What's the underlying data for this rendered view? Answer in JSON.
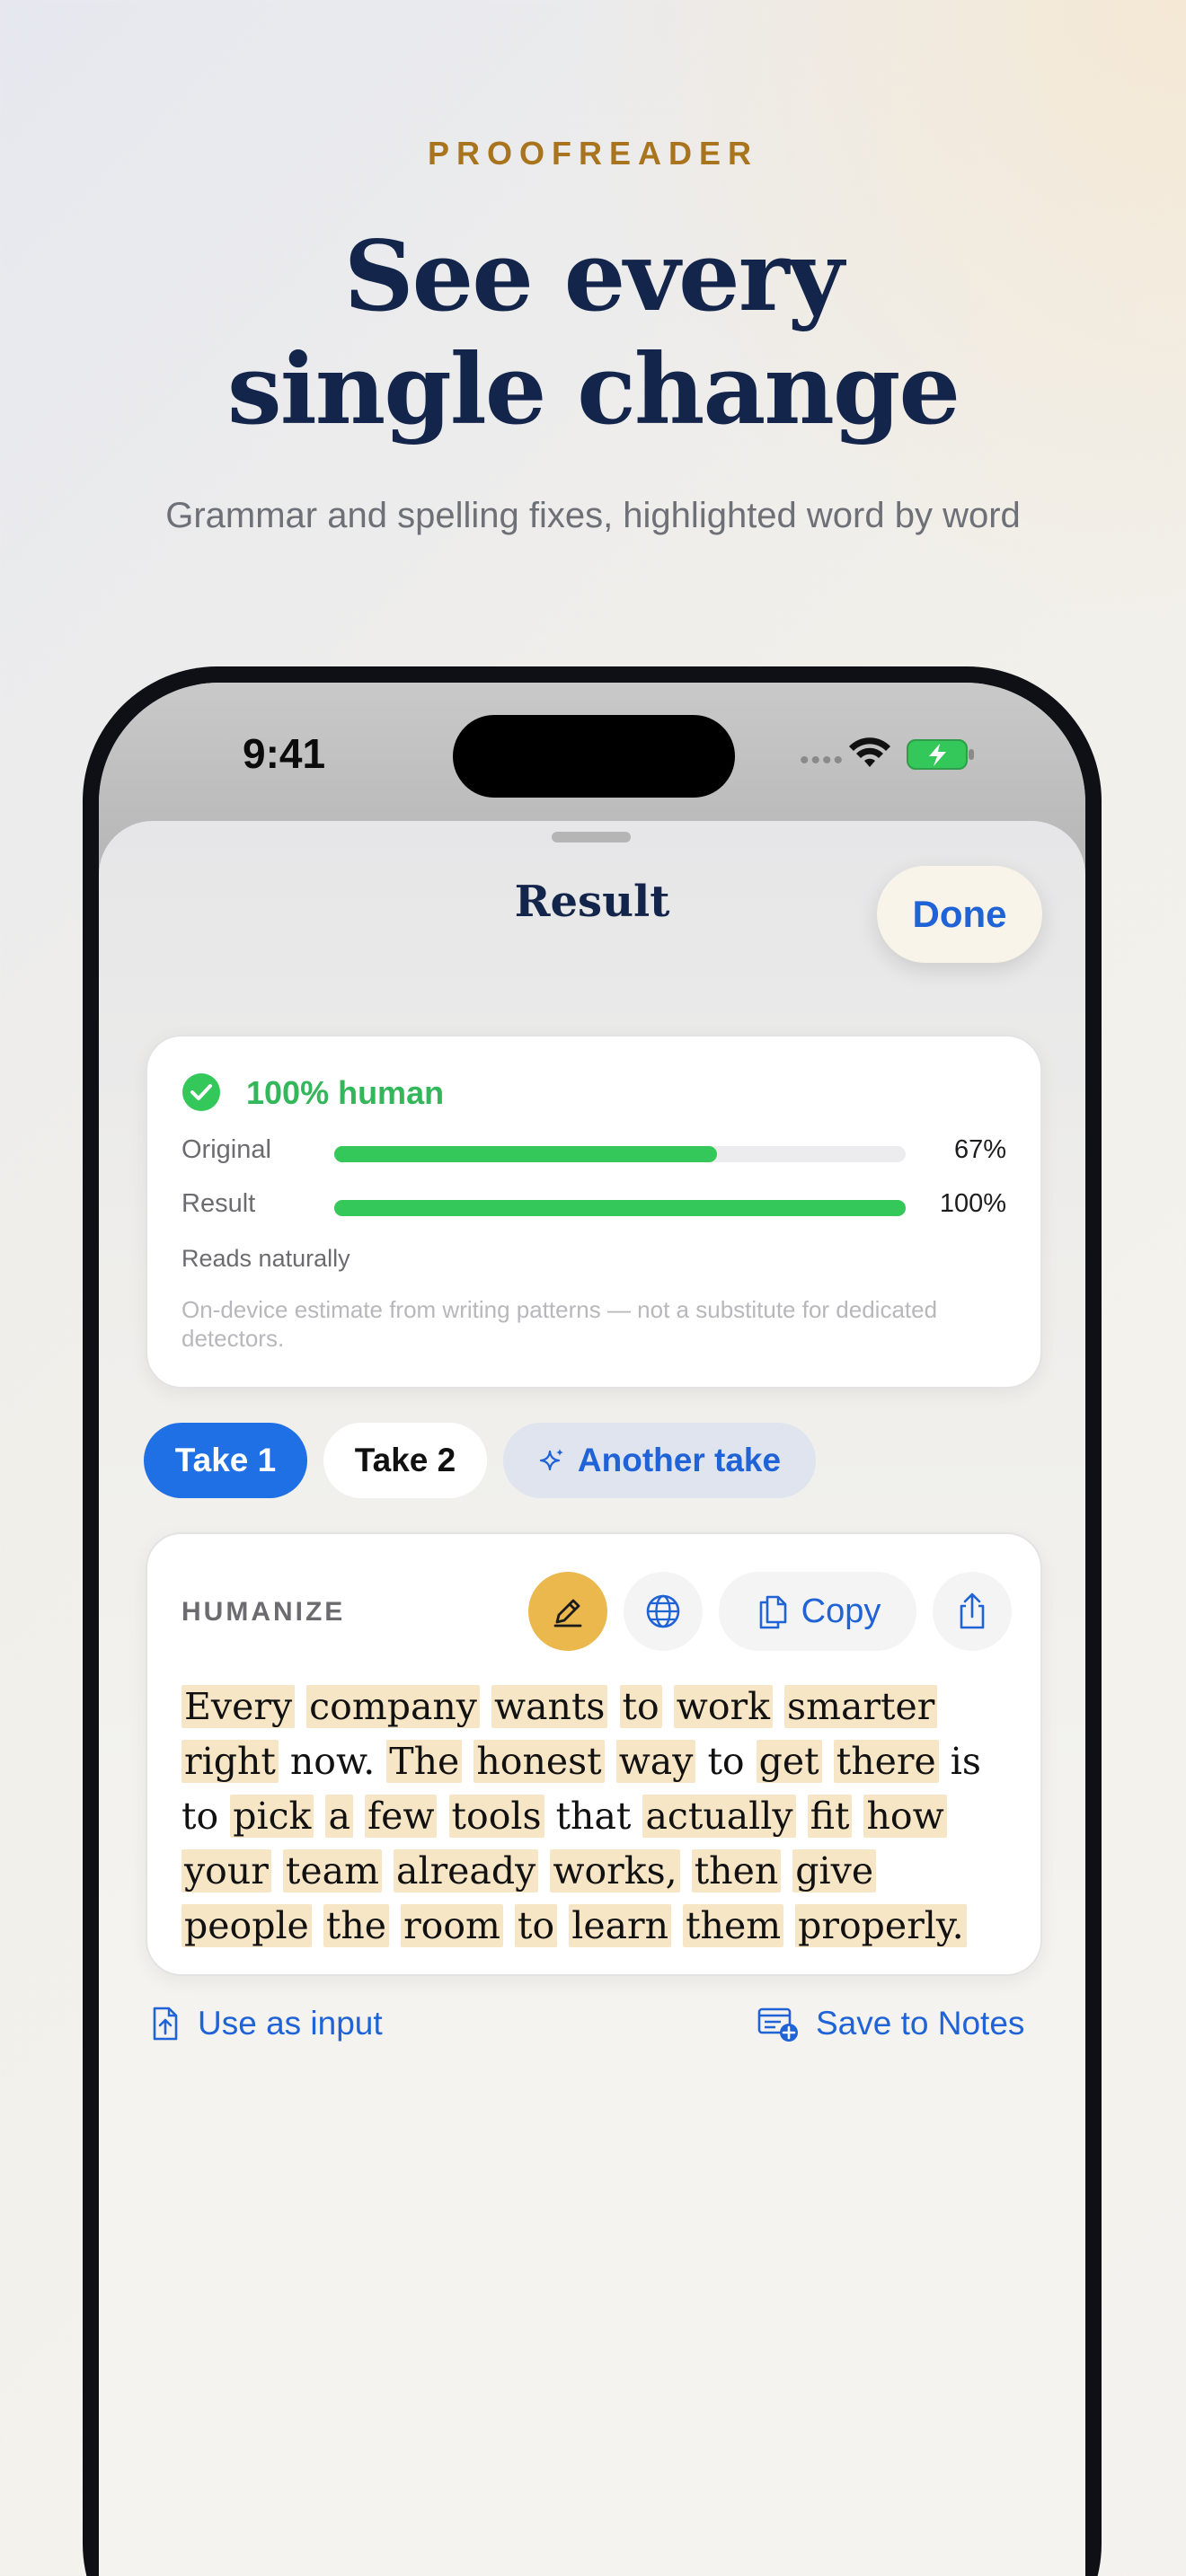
{
  "marketing": {
    "eyebrow": "PROOFREADER",
    "headline_line1": "See every",
    "headline_line2": "single change",
    "subhead": "Grammar and spelling fixes, highlighted word by word"
  },
  "status_bar": {
    "time": "9:41",
    "icons": [
      "signal-icon",
      "wifi-icon",
      "battery-charging-icon"
    ]
  },
  "sheet": {
    "title": "Result",
    "done_label": "Done"
  },
  "score": {
    "headline": "100% human",
    "rows": [
      {
        "label": "Original",
        "percent_text": "67%",
        "value": 0.67
      },
      {
        "label": "Result",
        "percent_text": "100%",
        "value": 1.0
      }
    ],
    "note": "Reads naturally",
    "disclaimer": "On-device estimate from writing patterns — not a substitute for dedicated detectors."
  },
  "takes": {
    "take1": "Take 1",
    "take2": "Take 2",
    "another": "Another take",
    "selected": "Take 1"
  },
  "output": {
    "mode_label": "HUMANIZE",
    "copy_label": "Copy",
    "text_tokens": [
      {
        "t": "Every",
        "h": true
      },
      {
        "t": "company",
        "h": true
      },
      {
        "t": "wants",
        "h": true
      },
      {
        "t": "to",
        "h": true
      },
      {
        "t": "work",
        "h": true
      },
      {
        "t": "smarter",
        "h": true
      },
      {
        "t": "right",
        "h": true
      },
      {
        "t": "now.",
        "h": false
      },
      {
        "t": "The",
        "h": true
      },
      {
        "t": "honest",
        "h": true
      },
      {
        "t": "way",
        "h": true
      },
      {
        "t": "to",
        "h": false
      },
      {
        "t": "get",
        "h": true
      },
      {
        "t": "there",
        "h": true
      },
      {
        "t": "is",
        "h": false
      },
      {
        "t": "to",
        "h": false
      },
      {
        "t": "pick",
        "h": true
      },
      {
        "t": "a",
        "h": true
      },
      {
        "t": "few",
        "h": true
      },
      {
        "t": "tools",
        "h": true
      },
      {
        "t": "that",
        "h": false
      },
      {
        "t": "actually",
        "h": true
      },
      {
        "t": "fit",
        "h": true
      },
      {
        "t": "how",
        "h": true
      },
      {
        "t": "your",
        "h": true
      },
      {
        "t": "team",
        "h": true
      },
      {
        "t": "already",
        "h": true
      },
      {
        "t": "works,",
        "h": true
      },
      {
        "t": "then",
        "h": true
      },
      {
        "t": "give",
        "h": true
      },
      {
        "t": "people",
        "h": true
      },
      {
        "t": "the",
        "h": true
      },
      {
        "t": "room",
        "h": true
      },
      {
        "t": "to",
        "h": true
      },
      {
        "t": "learn",
        "h": true
      },
      {
        "t": "them",
        "h": true
      },
      {
        "t": "properly.",
        "h": true
      }
    ]
  },
  "actions": {
    "use_as_input": "Use as input",
    "save_to_notes": "Save to Notes"
  },
  "colors": {
    "accent_blue": "#1f63d6",
    "success_green": "#34c759",
    "highlight": "#f7e6c6",
    "title_navy": "#14254b",
    "eyebrow_gold": "#a8741e"
  }
}
